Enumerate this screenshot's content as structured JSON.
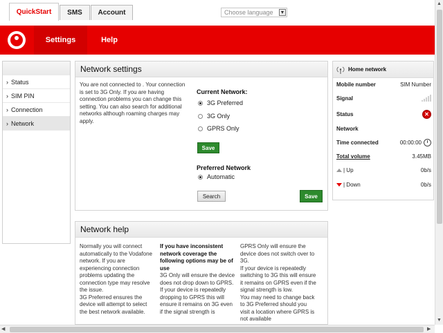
{
  "top_tabs": [
    "QuickStart",
    "SMS",
    "Account"
  ],
  "language_select": {
    "value": "Choose language"
  },
  "nav": {
    "settings": "Settings",
    "help": "Help"
  },
  "sidebar": {
    "items": [
      "Status",
      "SIM PIN",
      "Connection",
      "Network"
    ],
    "active_index": 3
  },
  "network_settings": {
    "title": "Network settings",
    "description": "You are not connected to . Your connection is set to 3G Only. If you are having connection problems you can change this setting. You can also search for additional networks although roaming charges may apply.",
    "current_network_label": "Current Network:",
    "current_network_options": [
      "3G Preferred",
      "3G Only",
      "GPRS Only"
    ],
    "current_network_selected": "3G Preferred",
    "save_label": "Save",
    "preferred_network_label": "Preferred Network",
    "preferred_network_option": "Automatic",
    "search_label": "Search",
    "save2_label": "Save"
  },
  "home_network": {
    "title": "Home network",
    "mobile_number_label": "Mobile number",
    "mobile_number_value": "SIM Number",
    "signal_label": "Signal",
    "status_label": "Status",
    "network_label": "Network",
    "time_connected_label": "Time connected",
    "time_connected_value": "00:00:00",
    "total_volume_label": "Total volume",
    "total_volume_value": "3.45MB",
    "up_label": "| Up",
    "up_value": "0b/s",
    "down_label": "| Down",
    "down_value": "0b/s"
  },
  "network_help": {
    "title": "Network help",
    "col1": [
      "Normally you will connect automatically to the Vodafone network. If you are experiencing connection problems updating the connection type may resolve the issue.",
      "3G Preferred ensures the device will attempt to select the best network available."
    ],
    "col2_heading": "If you have inconsistent network coverage the following options may be of use",
    "col2": [
      "3G Only will ensure the device does not drop down to GPRS.",
      "If your device is repeatedly dropping to GPRS this will ensure it remains on 3G even if the signal strength is"
    ],
    "col3": [
      "GPRS Only will ensure the device does not switch over to 3G.",
      "If your device is repeatedly switching to 3G this will ensure it remains on GPRS even if the signal strength is low.",
      "You may need to change back to 3G Preferred should you visit a location where GPRS is not available"
    ]
  },
  "icons": {
    "logo": "vodafone-logo",
    "home": "antenna-icon",
    "status": "error-x-icon",
    "clock": "clock-icon",
    "up": "up-arrow-icon",
    "down": "down-arrow-icon"
  },
  "colors": {
    "brand_red": "#e60000",
    "save_green": "#2d8a2d"
  }
}
